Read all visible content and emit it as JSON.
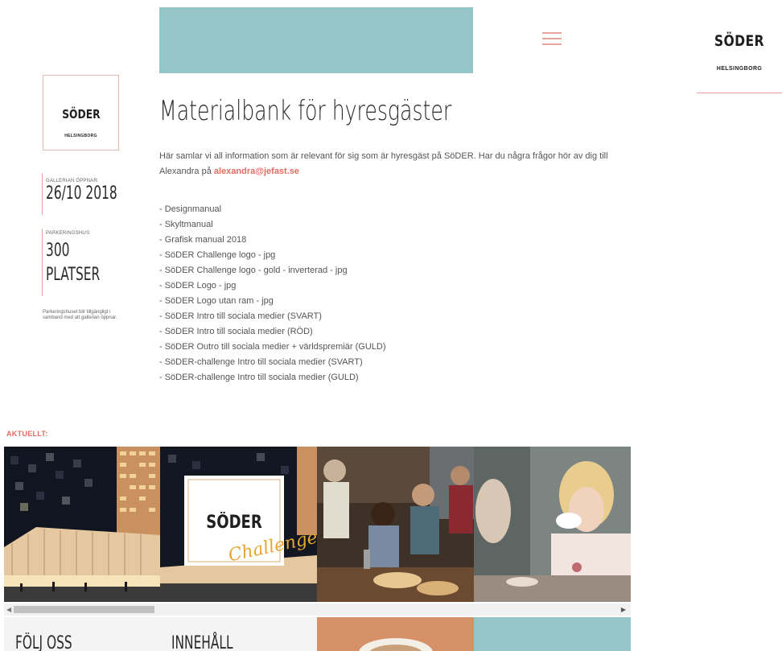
{
  "brand": {
    "name": "SÖDER",
    "city": "HELSINGBORG"
  },
  "sidebar": {
    "opening_label": "GALLERIAN ÖPPNAR:",
    "opening_value": "26/10 2018",
    "parking_label": "PARKERINGSHUS:",
    "parking_value_1": "300",
    "parking_value_2": "PLATSER",
    "parking_note": "Parkeringshuset blir tillgängligt i samband med att gallerian öppnar."
  },
  "main": {
    "title": "Materialbank för hyresgäster",
    "intro_text": "Här samlar vi all information som är relevant för sig som är hyresgäst på SöDER. Har du några frågor hör av dig till Alexandra på ",
    "intro_email": "alexandra@jefast.se",
    "files": [
      "- Designmanual",
      "- Skyltmanual",
      "- Grafisk manual 2018",
      "- SöDER Challenge logo - jpg",
      "- SöDER Challenge logo - gold - inverterad - jpg",
      "- SöDER Logo - jpg",
      "- SöDER Logo utan ram - jpg",
      "- SöDER Intro till sociala medier (SVART)",
      "- SöDER Intro till sociala medier (RÖD)",
      "- SöDER Outro till sociala medier + världspremiär (GULD)",
      "- SöDER-challenge Intro till sociala medier (SVART)",
      "- SöDER-challenge Intro till sociala medier (GULD)"
    ]
  },
  "news": {
    "heading": "AKTUELLT:",
    "challenge_name": "SÖDER",
    "challenge_script": "Challenge"
  },
  "footer": {
    "follow": "FÖLJ OSS",
    "content": "INNEHÅLL"
  },
  "colors": {
    "teal": "#95c6c7",
    "accent": "#e46b62",
    "line": "#e7a39c"
  }
}
